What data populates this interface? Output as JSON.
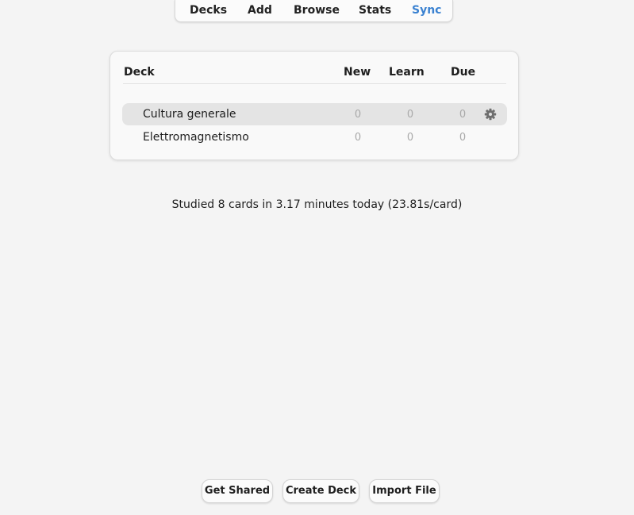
{
  "toolbar": {
    "items": [
      {
        "label": "Decks"
      },
      {
        "label": "Add"
      },
      {
        "label": "Browse"
      },
      {
        "label": "Stats"
      },
      {
        "label": "Sync"
      }
    ],
    "active_color": "#3b82d1"
  },
  "deck_table": {
    "headers": {
      "deck": "Deck",
      "new": "New",
      "learn": "Learn",
      "due": "Due"
    },
    "rows": [
      {
        "name": "Cultura generale",
        "new": "0",
        "learn": "0",
        "due": "0",
        "current": true,
        "icon": "gear-icon"
      },
      {
        "name": "Elettromagnetismo",
        "new": "0",
        "learn": "0",
        "due": "0",
        "current": false
      }
    ]
  },
  "summary": {
    "text": "Studied 8 cards in 3.17 minutes today (23.81s/card)"
  },
  "bottom_buttons": {
    "get_shared": "Get Shared",
    "create_deck": "Create Deck",
    "import_file": "Import File"
  }
}
